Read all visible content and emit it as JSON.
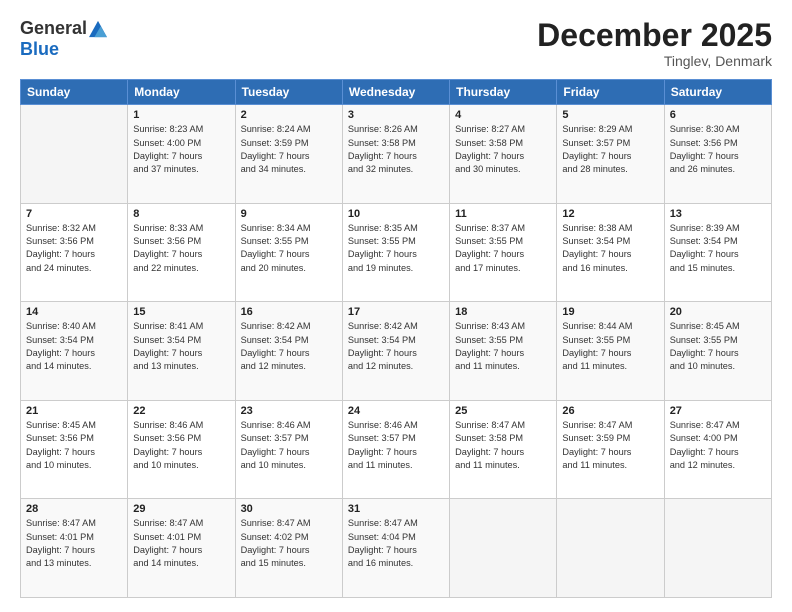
{
  "logo": {
    "general": "General",
    "blue": "Blue"
  },
  "header": {
    "month": "December 2025",
    "location": "Tinglev, Denmark"
  },
  "weekdays": [
    "Sunday",
    "Monday",
    "Tuesday",
    "Wednesday",
    "Thursday",
    "Friday",
    "Saturday"
  ],
  "weeks": [
    [
      {
        "day": "",
        "info": ""
      },
      {
        "day": "1",
        "info": "Sunrise: 8:23 AM\nSunset: 4:00 PM\nDaylight: 7 hours\nand 37 minutes."
      },
      {
        "day": "2",
        "info": "Sunrise: 8:24 AM\nSunset: 3:59 PM\nDaylight: 7 hours\nand 34 minutes."
      },
      {
        "day": "3",
        "info": "Sunrise: 8:26 AM\nSunset: 3:58 PM\nDaylight: 7 hours\nand 32 minutes."
      },
      {
        "day": "4",
        "info": "Sunrise: 8:27 AM\nSunset: 3:58 PM\nDaylight: 7 hours\nand 30 minutes."
      },
      {
        "day": "5",
        "info": "Sunrise: 8:29 AM\nSunset: 3:57 PM\nDaylight: 7 hours\nand 28 minutes."
      },
      {
        "day": "6",
        "info": "Sunrise: 8:30 AM\nSunset: 3:56 PM\nDaylight: 7 hours\nand 26 minutes."
      }
    ],
    [
      {
        "day": "7",
        "info": "Sunrise: 8:32 AM\nSunset: 3:56 PM\nDaylight: 7 hours\nand 24 minutes."
      },
      {
        "day": "8",
        "info": "Sunrise: 8:33 AM\nSunset: 3:56 PM\nDaylight: 7 hours\nand 22 minutes."
      },
      {
        "day": "9",
        "info": "Sunrise: 8:34 AM\nSunset: 3:55 PM\nDaylight: 7 hours\nand 20 minutes."
      },
      {
        "day": "10",
        "info": "Sunrise: 8:35 AM\nSunset: 3:55 PM\nDaylight: 7 hours\nand 19 minutes."
      },
      {
        "day": "11",
        "info": "Sunrise: 8:37 AM\nSunset: 3:55 PM\nDaylight: 7 hours\nand 17 minutes."
      },
      {
        "day": "12",
        "info": "Sunrise: 8:38 AM\nSunset: 3:54 PM\nDaylight: 7 hours\nand 16 minutes."
      },
      {
        "day": "13",
        "info": "Sunrise: 8:39 AM\nSunset: 3:54 PM\nDaylight: 7 hours\nand 15 minutes."
      }
    ],
    [
      {
        "day": "14",
        "info": "Sunrise: 8:40 AM\nSunset: 3:54 PM\nDaylight: 7 hours\nand 14 minutes."
      },
      {
        "day": "15",
        "info": "Sunrise: 8:41 AM\nSunset: 3:54 PM\nDaylight: 7 hours\nand 13 minutes."
      },
      {
        "day": "16",
        "info": "Sunrise: 8:42 AM\nSunset: 3:54 PM\nDaylight: 7 hours\nand 12 minutes."
      },
      {
        "day": "17",
        "info": "Sunrise: 8:42 AM\nSunset: 3:54 PM\nDaylight: 7 hours\nand 12 minutes."
      },
      {
        "day": "18",
        "info": "Sunrise: 8:43 AM\nSunset: 3:55 PM\nDaylight: 7 hours\nand 11 minutes."
      },
      {
        "day": "19",
        "info": "Sunrise: 8:44 AM\nSunset: 3:55 PM\nDaylight: 7 hours\nand 11 minutes."
      },
      {
        "day": "20",
        "info": "Sunrise: 8:45 AM\nSunset: 3:55 PM\nDaylight: 7 hours\nand 10 minutes."
      }
    ],
    [
      {
        "day": "21",
        "info": "Sunrise: 8:45 AM\nSunset: 3:56 PM\nDaylight: 7 hours\nand 10 minutes."
      },
      {
        "day": "22",
        "info": "Sunrise: 8:46 AM\nSunset: 3:56 PM\nDaylight: 7 hours\nand 10 minutes."
      },
      {
        "day": "23",
        "info": "Sunrise: 8:46 AM\nSunset: 3:57 PM\nDaylight: 7 hours\nand 10 minutes."
      },
      {
        "day": "24",
        "info": "Sunrise: 8:46 AM\nSunset: 3:57 PM\nDaylight: 7 hours\nand 11 minutes."
      },
      {
        "day": "25",
        "info": "Sunrise: 8:47 AM\nSunset: 3:58 PM\nDaylight: 7 hours\nand 11 minutes."
      },
      {
        "day": "26",
        "info": "Sunrise: 8:47 AM\nSunset: 3:59 PM\nDaylight: 7 hours\nand 11 minutes."
      },
      {
        "day": "27",
        "info": "Sunrise: 8:47 AM\nSunset: 4:00 PM\nDaylight: 7 hours\nand 12 minutes."
      }
    ],
    [
      {
        "day": "28",
        "info": "Sunrise: 8:47 AM\nSunset: 4:01 PM\nDaylight: 7 hours\nand 13 minutes."
      },
      {
        "day": "29",
        "info": "Sunrise: 8:47 AM\nSunset: 4:01 PM\nDaylight: 7 hours\nand 14 minutes."
      },
      {
        "day": "30",
        "info": "Sunrise: 8:47 AM\nSunset: 4:02 PM\nDaylight: 7 hours\nand 15 minutes."
      },
      {
        "day": "31",
        "info": "Sunrise: 8:47 AM\nSunset: 4:04 PM\nDaylight: 7 hours\nand 16 minutes."
      },
      {
        "day": "",
        "info": ""
      },
      {
        "day": "",
        "info": ""
      },
      {
        "day": "",
        "info": ""
      }
    ]
  ]
}
